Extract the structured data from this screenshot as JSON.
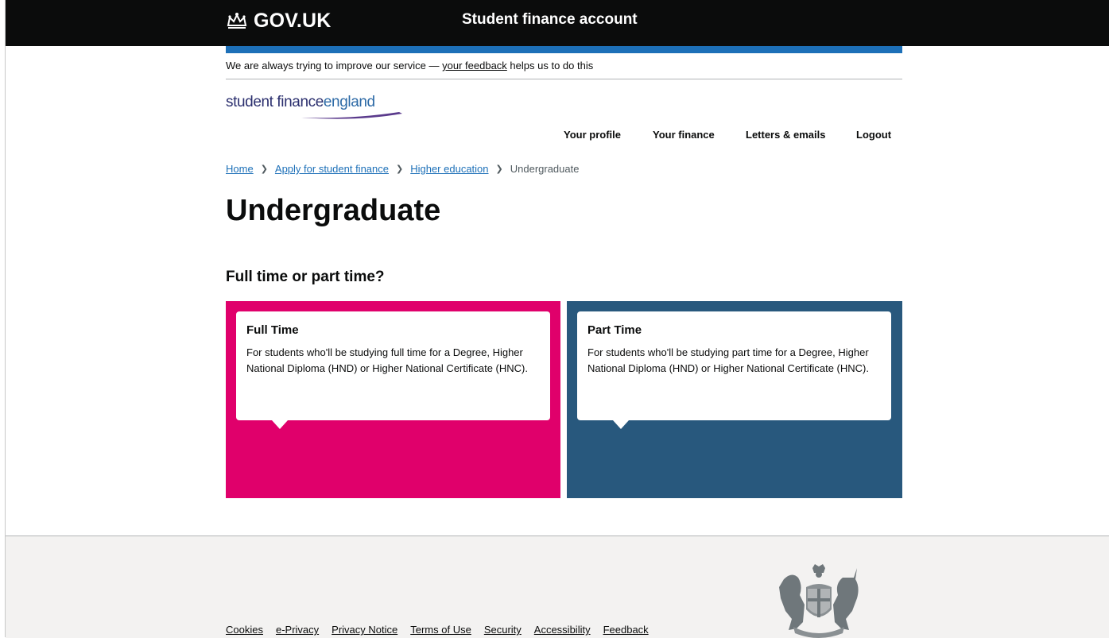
{
  "header": {
    "logo_text": "GOV.UK",
    "service_name": "Student finance account"
  },
  "feedback_banner": {
    "prefix": "We are always trying to improve our service — ",
    "link": "your feedback",
    "suffix": " helps us to do this"
  },
  "brand": {
    "part1": "student finance",
    "part2": "england"
  },
  "nav": {
    "items": [
      {
        "label": "Your profile"
      },
      {
        "label": "Your finance"
      },
      {
        "label": "Letters & emails"
      },
      {
        "label": "Logout"
      }
    ]
  },
  "breadcrumb": {
    "items": [
      "Home",
      "Apply for student finance",
      "Higher education"
    ],
    "current": "Undergraduate"
  },
  "page": {
    "title": "Undergraduate",
    "question": "Full time or part time?"
  },
  "options": [
    {
      "title": "Full Time",
      "description": "For students who'll be studying full time for a Degree, Higher National Diploma (HND) or Higher National Certificate (HNC).",
      "color": "#e0006b"
    },
    {
      "title": "Part Time",
      "description": "For students who'll be studying part time for a Degree, Higher National Diploma (HND) or Higher National Certificate (HNC).",
      "color": "#28587d"
    }
  ],
  "footer": {
    "links": [
      "Cookies",
      "e-Privacy",
      "Privacy Notice",
      "Terms of Use",
      "Security",
      "Accessibility",
      "Feedback"
    ],
    "crest_icon": "royal-coat-of-arms-icon"
  },
  "colors": {
    "header_bg": "#0b0c0c",
    "accent_blue": "#1d70b8",
    "link": "#1d70b8",
    "footer_bg": "#f3f2f1"
  }
}
